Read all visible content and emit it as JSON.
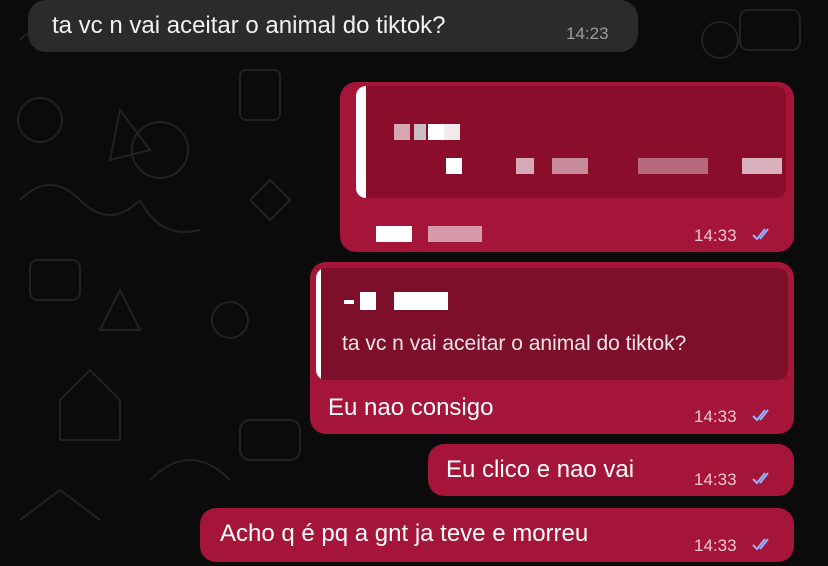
{
  "colors": {
    "background": "#0b0b0b",
    "incoming_bubble": "#2b2b2d",
    "outgoing_bubble": "#a5153a",
    "quote_background": "#7e0f2b",
    "read_ticks": "#8fb4ff"
  },
  "messages": [
    {
      "direction": "incoming",
      "text": "ta vc n vai aceitar o animal do tiktok?",
      "time": "14:23"
    },
    {
      "direction": "outgoing",
      "reply_quote": "",
      "text": "",
      "time": "14:33",
      "status_icon": "double-check-icon",
      "redacted": true
    },
    {
      "direction": "outgoing",
      "reply_quote": "ta vc n vai aceitar o animal do tiktok?",
      "text": "Eu nao consigo",
      "time": "14:33",
      "status_icon": "double-check-icon"
    },
    {
      "direction": "outgoing",
      "text": "Eu clico e nao vai",
      "time": "14:33",
      "status_icon": "double-check-icon"
    },
    {
      "direction": "outgoing",
      "text": "Acho q é pq a gnt ja teve e morreu",
      "time": "14:33",
      "status_icon": "double-check-icon"
    }
  ]
}
